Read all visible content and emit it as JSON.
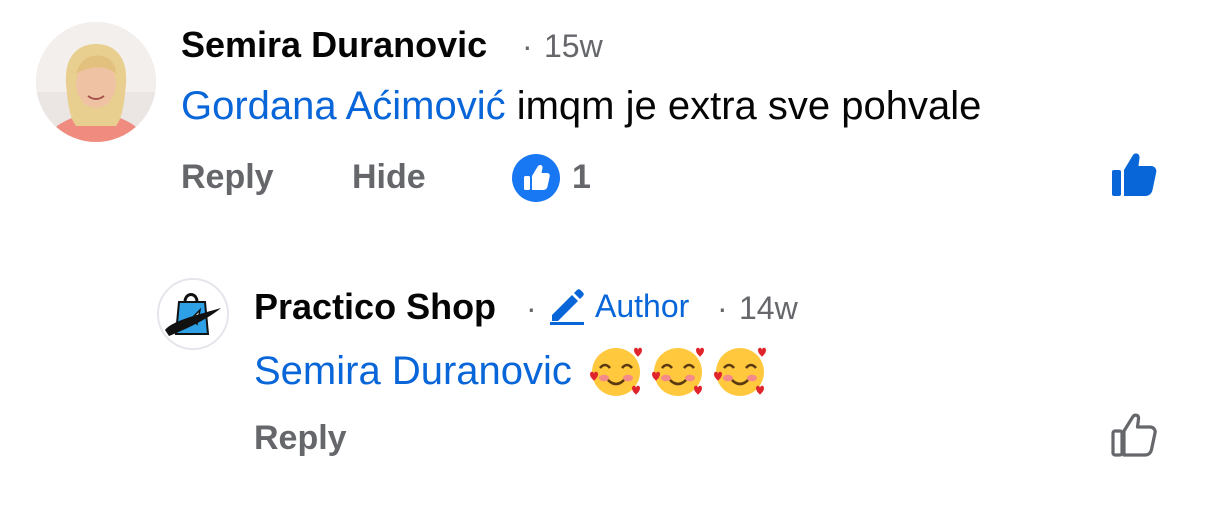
{
  "comment": {
    "author": "Semira Duranovic",
    "separator": "·",
    "time": "15w",
    "mention": "Gordana Aćimović",
    "text": "imqm je extra sve pohvale",
    "actions": {
      "reply": "Reply",
      "hide": "Hide"
    },
    "reaction_count": "1",
    "reaction_icon": "like-filled-icon",
    "like_icon": "thumbs-up-filled-icon"
  },
  "reply": {
    "author": "Practico Shop",
    "separator": "·",
    "badge_icon": "pencil-icon",
    "badge_label": "Author",
    "time_separator": "·",
    "time": "14w",
    "mention": "Semira Duranovic",
    "emojis": [
      "🥰",
      "🥰",
      "🥰"
    ],
    "actions": {
      "reply": "Reply"
    },
    "like_icon": "thumbs-up-outline-icon"
  },
  "colors": {
    "link_blue": "#0866d9",
    "secondary_text": "#65676b",
    "primary_text": "#050505"
  }
}
